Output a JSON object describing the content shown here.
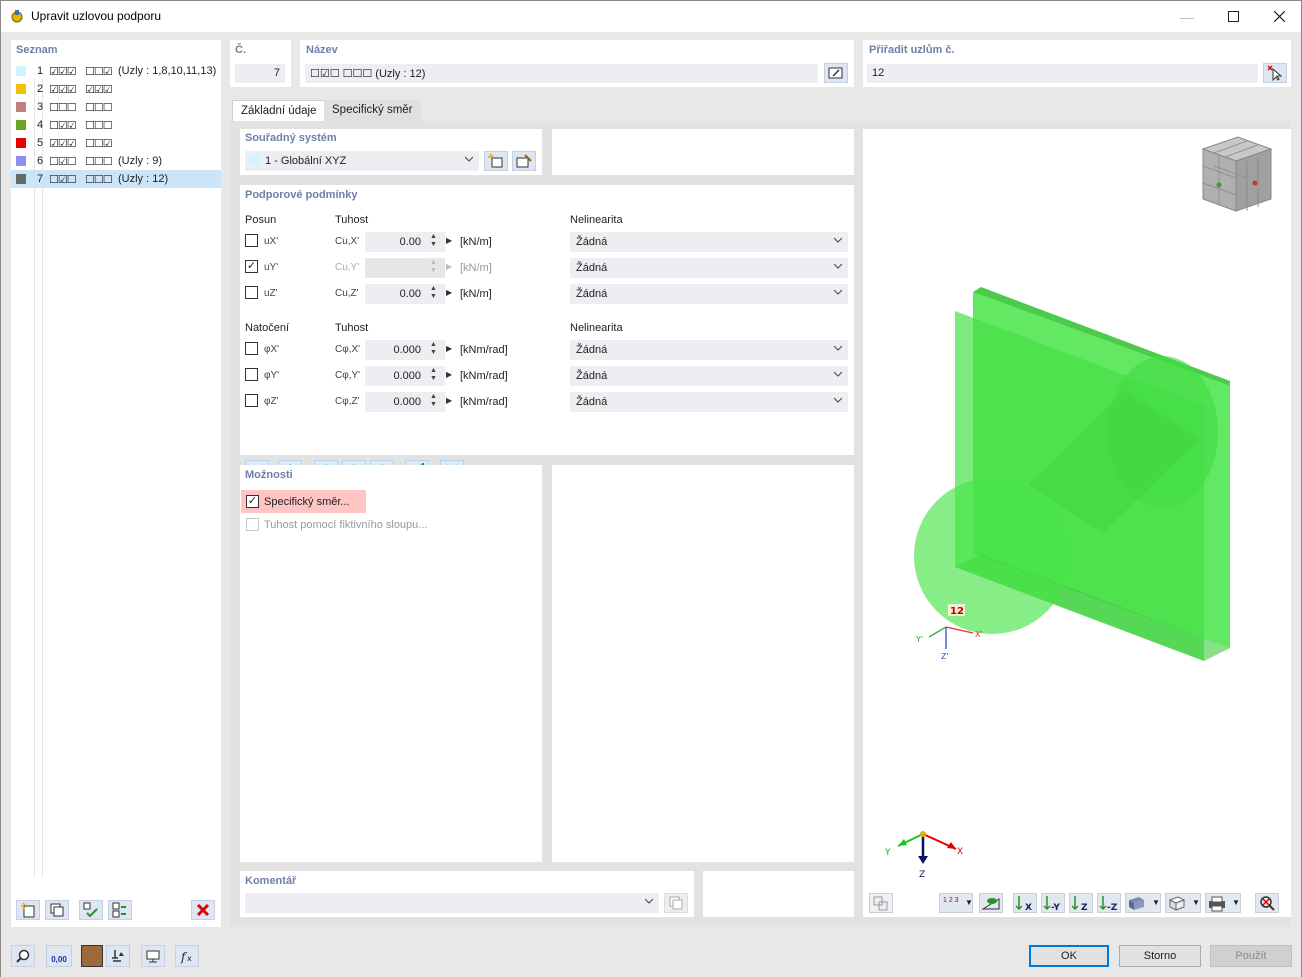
{
  "window": {
    "title": "Upravit uzlovou podporu"
  },
  "list": {
    "header": "Seznam",
    "items": [
      {
        "num": "1",
        "color": "#ccf5ff",
        "t1": "☑☑☑",
        "t2": "☐☐☑",
        "label": "(Uzly : 1,8,10,11,13)"
      },
      {
        "num": "2",
        "color": "#f2c200",
        "t1": "☑☑☑",
        "t2": "☑☑☑",
        "label": ""
      },
      {
        "num": "3",
        "color": "#c47f7f",
        "t1": "☐☐☐",
        "t2": "☐☐☐",
        "label": ""
      },
      {
        "num": "4",
        "color": "#6aa522",
        "t1": "☐☑☑",
        "t2": "☐☐☐",
        "label": ""
      },
      {
        "num": "5",
        "color": "#e60000",
        "t1": "☑☑☑",
        "t2": "☐☐☑",
        "label": ""
      },
      {
        "num": "6",
        "color": "#8f8ff0",
        "t1": "☐☑☐",
        "t2": "☐☐☐",
        "label": "(Uzly : 9)"
      },
      {
        "num": "7",
        "color": "#646d64",
        "t1": "☐☑☐",
        "t2": "☐☐☐",
        "label": "(Uzly : 12)"
      }
    ]
  },
  "header": {
    "no_label": "Č.",
    "no_value": "7",
    "name_label": "Název",
    "name_value": "☐☑☐ ☐☐☐ (Uzly : 12)",
    "assign_label": "Přiřadit uzlům č.",
    "assign_value": "12"
  },
  "tabs": {
    "basic": "Základní údaje",
    "specific": "Specifický směr"
  },
  "coord": {
    "label": "Souřadný systém",
    "value": "1 - Globální XYZ"
  },
  "support": {
    "label": "Podporové podmínky",
    "posun": "Posun",
    "tuhost": "Tuhost",
    "nelin": "Nelinearita",
    "natoceni": "Natočení",
    "rows_t": [
      {
        "dof": "uX'",
        "stiff": "Cu,X'",
        "value": "0.00",
        "unit": "[kN/m]",
        "nonlin": "Žádná",
        "checked": false
      },
      {
        "dof": "uY'",
        "stiff": "Cu,Y'",
        "value": "",
        "unit": "[kN/m]",
        "nonlin": "Žádná",
        "checked": true
      },
      {
        "dof": "uZ'",
        "stiff": "Cu,Z'",
        "value": "0.00",
        "unit": "[kN/m]",
        "nonlin": "Žádná",
        "checked": false
      }
    ],
    "rows_r": [
      {
        "dof": "φX'",
        "stiff": "Cφ,X'",
        "value": "0.000",
        "unit": "[kNm/rad]",
        "nonlin": "Žádná"
      },
      {
        "dof": "φY'",
        "stiff": "Cφ,Y'",
        "value": "0.000",
        "unit": "[kNm/rad]",
        "nonlin": "Žádná"
      },
      {
        "dof": "φZ'",
        "stiff": "Cφ,Z'",
        "value": "0.000",
        "unit": "[kNm/rad]",
        "nonlin": "Žádná"
      }
    ]
  },
  "options": {
    "label": "Možnosti",
    "specific": "Specifický směr...",
    "column": "Tuhost pomocí fiktivního sloupu..."
  },
  "comment": {
    "label": "Komentář"
  },
  "view": {
    "node_label": "12",
    "axes": {
      "x": "X",
      "y": "Y",
      "z": "Z"
    },
    "local": {
      "x": "X'",
      "y": "Y'",
      "z": "Z'"
    },
    "numbers_icon": "1 2 3"
  },
  "buttons": {
    "ok": "OK",
    "cancel": "Storno",
    "apply": "Použít",
    "units": "0,00"
  },
  "colors": {
    "accent": "#6e7fa6",
    "selection": "#cce4f7",
    "highlight": "#ffc4c4",
    "solid": "#33e033"
  }
}
